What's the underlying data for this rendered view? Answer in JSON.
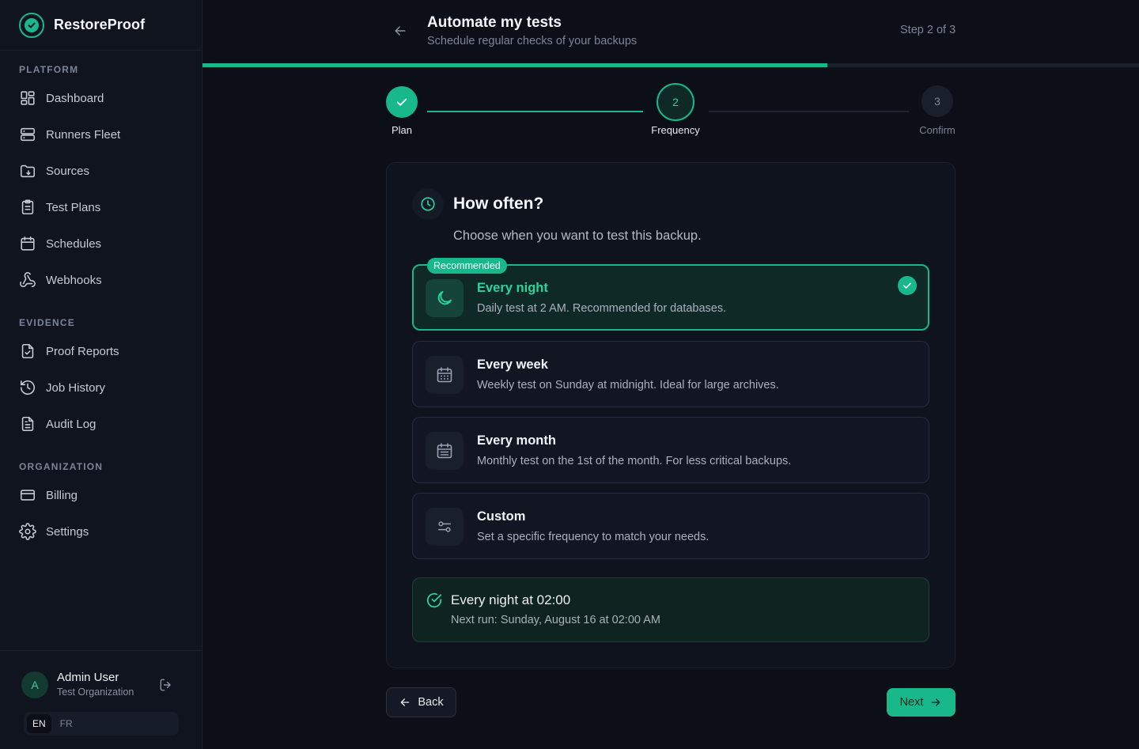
{
  "brand": {
    "name": "RestoreProof"
  },
  "sidebar": {
    "sections": [
      {
        "title": "PLATFORM",
        "items": [
          {
            "label": "Dashboard",
            "icon": "dashboard-icon"
          },
          {
            "label": "Runners Fleet",
            "icon": "server-icon"
          },
          {
            "label": "Sources",
            "icon": "folder-icon"
          },
          {
            "label": "Test Plans",
            "icon": "clipboard-icon"
          },
          {
            "label": "Schedules",
            "icon": "calendar-icon"
          },
          {
            "label": "Webhooks",
            "icon": "webhook-icon"
          }
        ]
      },
      {
        "title": "EVIDENCE",
        "items": [
          {
            "label": "Proof Reports",
            "icon": "file-check-icon"
          },
          {
            "label": "Job History",
            "icon": "history-icon"
          },
          {
            "label": "Audit Log",
            "icon": "file-text-icon"
          }
        ]
      },
      {
        "title": "ORGANIZATION",
        "items": [
          {
            "label": "Billing",
            "icon": "credit-card-icon"
          },
          {
            "label": "Settings",
            "icon": "gear-icon"
          }
        ]
      }
    ]
  },
  "user": {
    "initial": "A",
    "name": "Admin User",
    "org": "Test Organization",
    "languages": [
      "EN",
      "FR"
    ],
    "active_language": "EN"
  },
  "header": {
    "title": "Automate my tests",
    "subtitle": "Schedule regular checks of your backups",
    "step_indicator": "Step 2 of 3",
    "progress": 0.667
  },
  "stepper": {
    "steps": [
      {
        "number": "1",
        "label": "Plan",
        "state": "done"
      },
      {
        "number": "2",
        "label": "Frequency",
        "state": "current"
      },
      {
        "number": "3",
        "label": "Confirm",
        "state": "upcoming"
      }
    ]
  },
  "card": {
    "title": "How often?",
    "subtitle": "Choose when you want to test this backup.",
    "options": [
      {
        "title": "Every night",
        "description": "Daily test at 2 AM. Recommended for databases.",
        "badge": "Recommended",
        "selected": true,
        "icon": "moon-icon"
      },
      {
        "title": "Every week",
        "description": "Weekly test on Sunday at midnight. Ideal for large archives.",
        "selected": false,
        "icon": "calendar-week-icon"
      },
      {
        "title": "Every month",
        "description": "Monthly test on the 1st of the month. For less critical backups.",
        "selected": false,
        "icon": "calendar-month-icon"
      },
      {
        "title": "Custom",
        "description": "Set a specific frequency to match your needs.",
        "selected": false,
        "icon": "sliders-icon"
      }
    ],
    "summary": {
      "title": "Every night at 02:00",
      "next_run": "Next run: Sunday, August 16 at 02:00 AM"
    }
  },
  "actions": {
    "back_label": "Back",
    "next_label": "Next"
  },
  "colors": {
    "accent": "#19b88a",
    "background": "#0c0f18",
    "sidebar": "#10141f"
  }
}
